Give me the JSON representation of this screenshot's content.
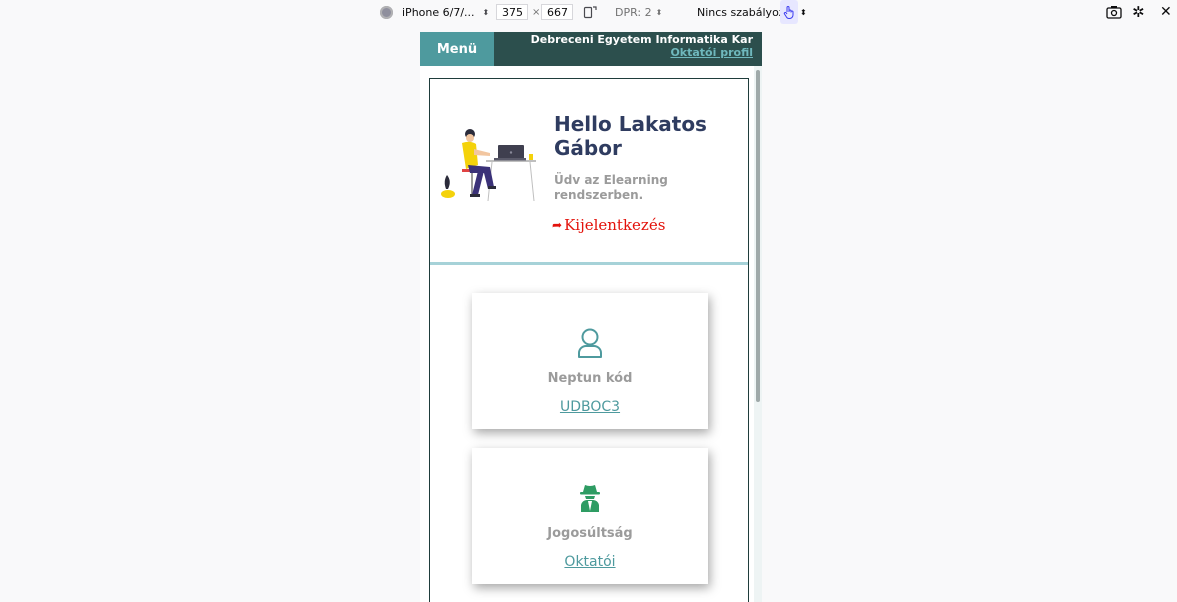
{
  "devtools": {
    "device": "iPhone 6/7/...",
    "width": "375",
    "times": "×",
    "height": "667",
    "dpr": "DPR: 2",
    "throttling": "Nincs szabályozás"
  },
  "header": {
    "menu_label": "Menü",
    "institution": "Debreceni Egyetem Informatika Kar",
    "profile_link": "Oktatói profil"
  },
  "hello": {
    "title": "Hello Lakatos Gábor",
    "welcome": "Üdv az Elearning rendszerben.",
    "logout": "Kijelentkezés"
  },
  "cards": [
    {
      "icon": "user-icon",
      "label": "Neptun kód",
      "value": "UDBOC3"
    },
    {
      "icon": "spy-icon",
      "label": "Jogosúltság",
      "value": "Oktatói"
    }
  ],
  "colors": {
    "header_bg": "#2c4f4d",
    "menu_bg": "#4e9a9e",
    "title": "#2f3c60",
    "logout": "#e3120b",
    "link": "#4e9a9e",
    "divider": "#a6d2d8",
    "spy_icon": "#2e9c63"
  }
}
